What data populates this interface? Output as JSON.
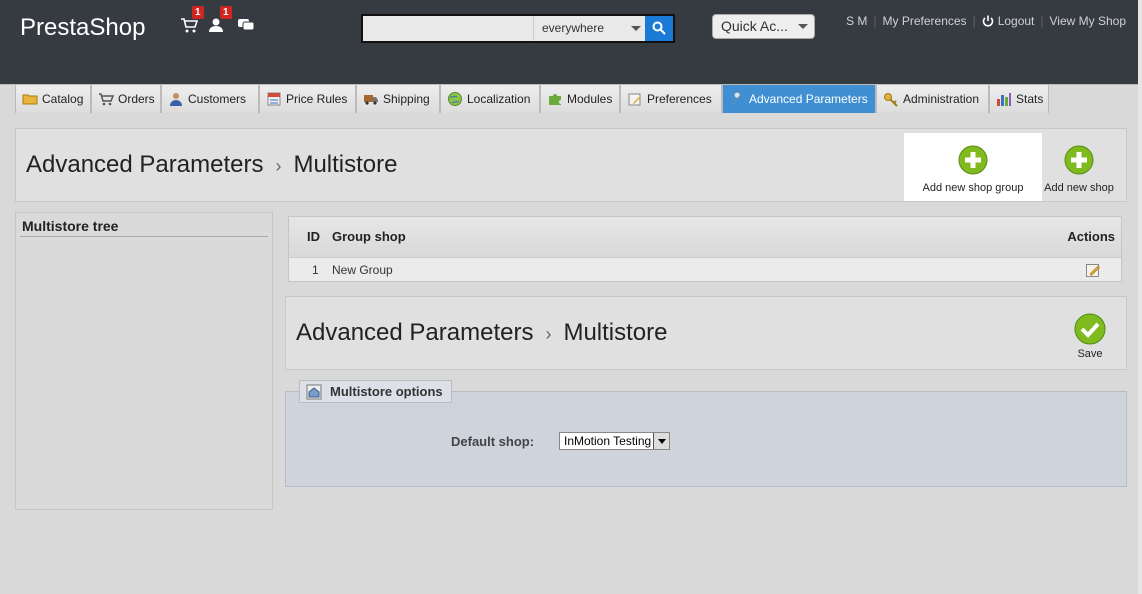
{
  "header": {
    "logo": "PrestaShop",
    "notifications": [
      {
        "icon": "cart-icon",
        "count": "1"
      },
      {
        "icon": "users-icon",
        "count": "1"
      },
      {
        "icon": "messages-icon",
        "count": ""
      }
    ],
    "search": {
      "value": "",
      "scope": "everywhere"
    },
    "quick_access": "Quick Ac...",
    "user": "S M",
    "links": [
      "My Preferences",
      "Logout",
      "View My Shop"
    ]
  },
  "tabs": [
    {
      "label": "Catalog",
      "icon": "folder-icon"
    },
    {
      "label": "Orders",
      "icon": "cart-icon"
    },
    {
      "label": "Customers",
      "icon": "customer-icon"
    },
    {
      "label": "Price Rules",
      "icon": "price-rules-icon"
    },
    {
      "label": "Shipping",
      "icon": "truck-icon"
    },
    {
      "label": "Localization",
      "icon": "globe-icon"
    },
    {
      "label": "Modules",
      "icon": "puzzle-icon"
    },
    {
      "label": "Preferences",
      "icon": "preferences-icon"
    },
    {
      "label": "Advanced Parameters",
      "icon": "wrench-icon",
      "active": true
    },
    {
      "label": "Administration",
      "icon": "key-icon"
    },
    {
      "label": "Stats",
      "icon": "chart-icon"
    }
  ],
  "toolbar": {
    "crumb1": "Advanced Parameters",
    "crumb2": "Multistore",
    "add_group": "Add new shop group",
    "add_shop": "Add new shop"
  },
  "tree": {
    "title": "Multistore tree"
  },
  "table": {
    "headers": {
      "id": "ID",
      "group": "Group shop",
      "actions": "Actions"
    },
    "rows": [
      {
        "id": "1",
        "group": "New Group"
      }
    ]
  },
  "toolbar2": {
    "crumb1": "Advanced Parameters",
    "crumb2": "Multistore",
    "save": "Save"
  },
  "options": {
    "legend": "Multistore options",
    "default_shop_label": "Default shop:",
    "default_shop_value": "InMotion Testing"
  },
  "colors": {
    "header_bg": "#363a41",
    "active_tab": "#3f8fd2",
    "add_green": "#7fba1f",
    "badge_red": "#d0261f"
  }
}
